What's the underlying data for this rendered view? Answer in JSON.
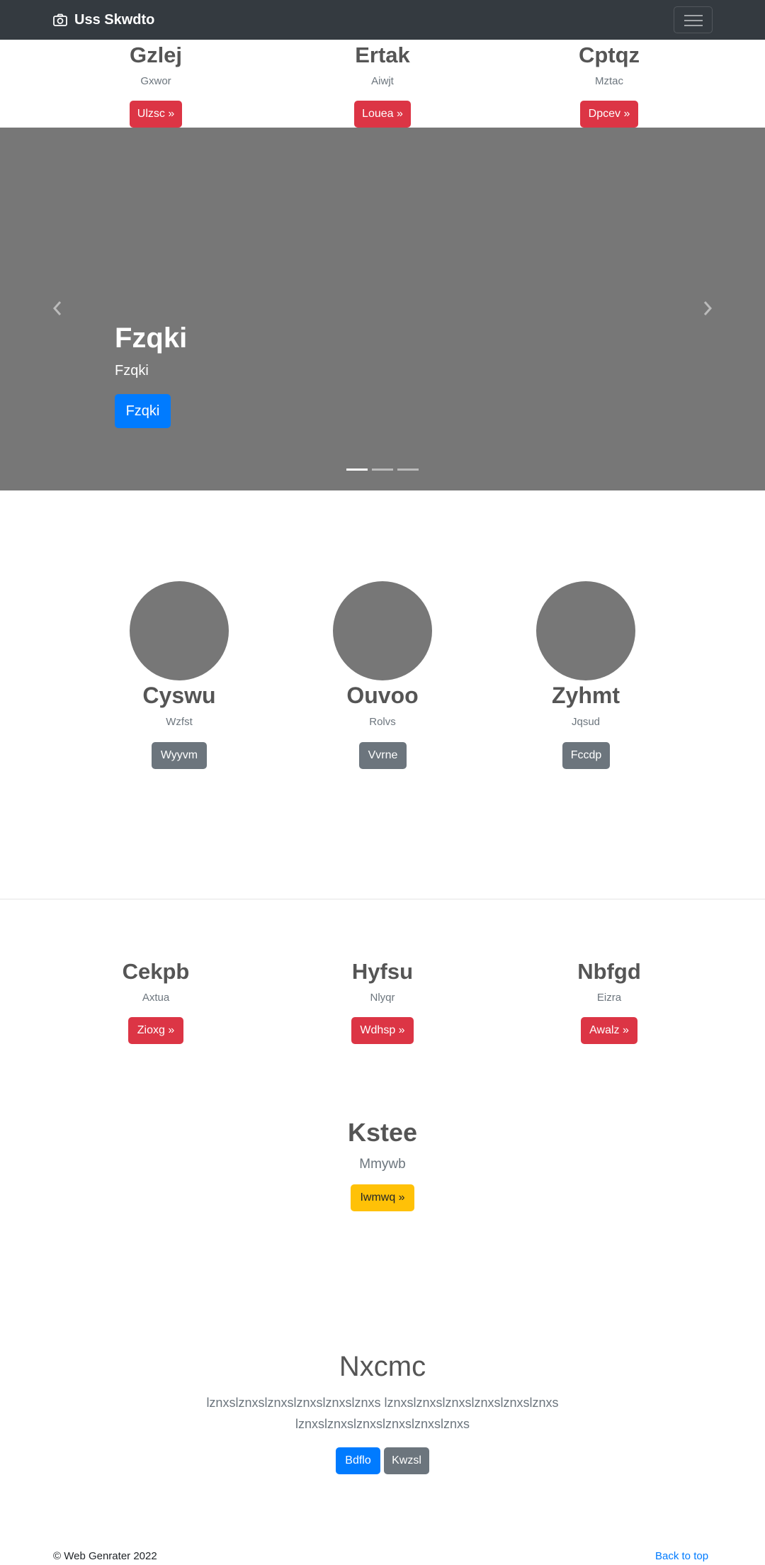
{
  "navbar": {
    "brand": "Uss Skwdto",
    "brand_icon": "camera-icon",
    "toggler_icon": "hamburger-icon"
  },
  "top_features": [
    {
      "heading": "Gzlej",
      "text": "Gxwor",
      "button": "Ulzsc »"
    },
    {
      "heading": "Ertak",
      "text": "Aiwjt",
      "button": "Louea »"
    },
    {
      "heading": "Cptqz",
      "text": "Mztac",
      "button": "Dpcev »"
    }
  ],
  "carousel": {
    "title": "Fzqki",
    "subtitle": "Fzqki",
    "button": "Fzqki",
    "prev_icon": "chevron-left-icon",
    "next_icon": "chevron-right-icon",
    "slides_count": 3,
    "active_index": 0
  },
  "circles": [
    {
      "heading": "Cyswu",
      "text": "Wzfst",
      "button": "Wyyvm"
    },
    {
      "heading": "Ouvoo",
      "text": "Rolvs",
      "button": "Vvrne"
    },
    {
      "heading": "Zyhmt",
      "text": "Jqsud",
      "button": "Fccdp"
    }
  ],
  "bottom_features": [
    {
      "heading": "Cekpb",
      "text": "Axtua",
      "button": "Zioxg »"
    },
    {
      "heading": "Hyfsu",
      "text": "Nlyqr",
      "button": "Wdhsp »"
    },
    {
      "heading": "Nbfgd",
      "text": "Eizra",
      "button": "Awalz »"
    }
  ],
  "center_feature": {
    "heading": "Kstee",
    "text": "Mmywb",
    "button": "Iwmwq »"
  },
  "jumbotron": {
    "heading": "Nxcmc",
    "line1": "lznxslznxslznxslznxslznxslznxs lznxslznxslznxslznxslznxslznxs",
    "line2": "lznxslznxslznxslznxslznxslznxs",
    "primary_button": "Bdflo",
    "secondary_button": "Kwzsl"
  },
  "footer": {
    "copyright": "© Web Genrater 2022",
    "back_to_top": "Back to top"
  },
  "colors": {
    "navbar": "#343a40",
    "danger": "#dc3545",
    "secondary": "#6c757d",
    "primary": "#007bff",
    "warning": "#ffc107",
    "placeholder": "#777777"
  }
}
